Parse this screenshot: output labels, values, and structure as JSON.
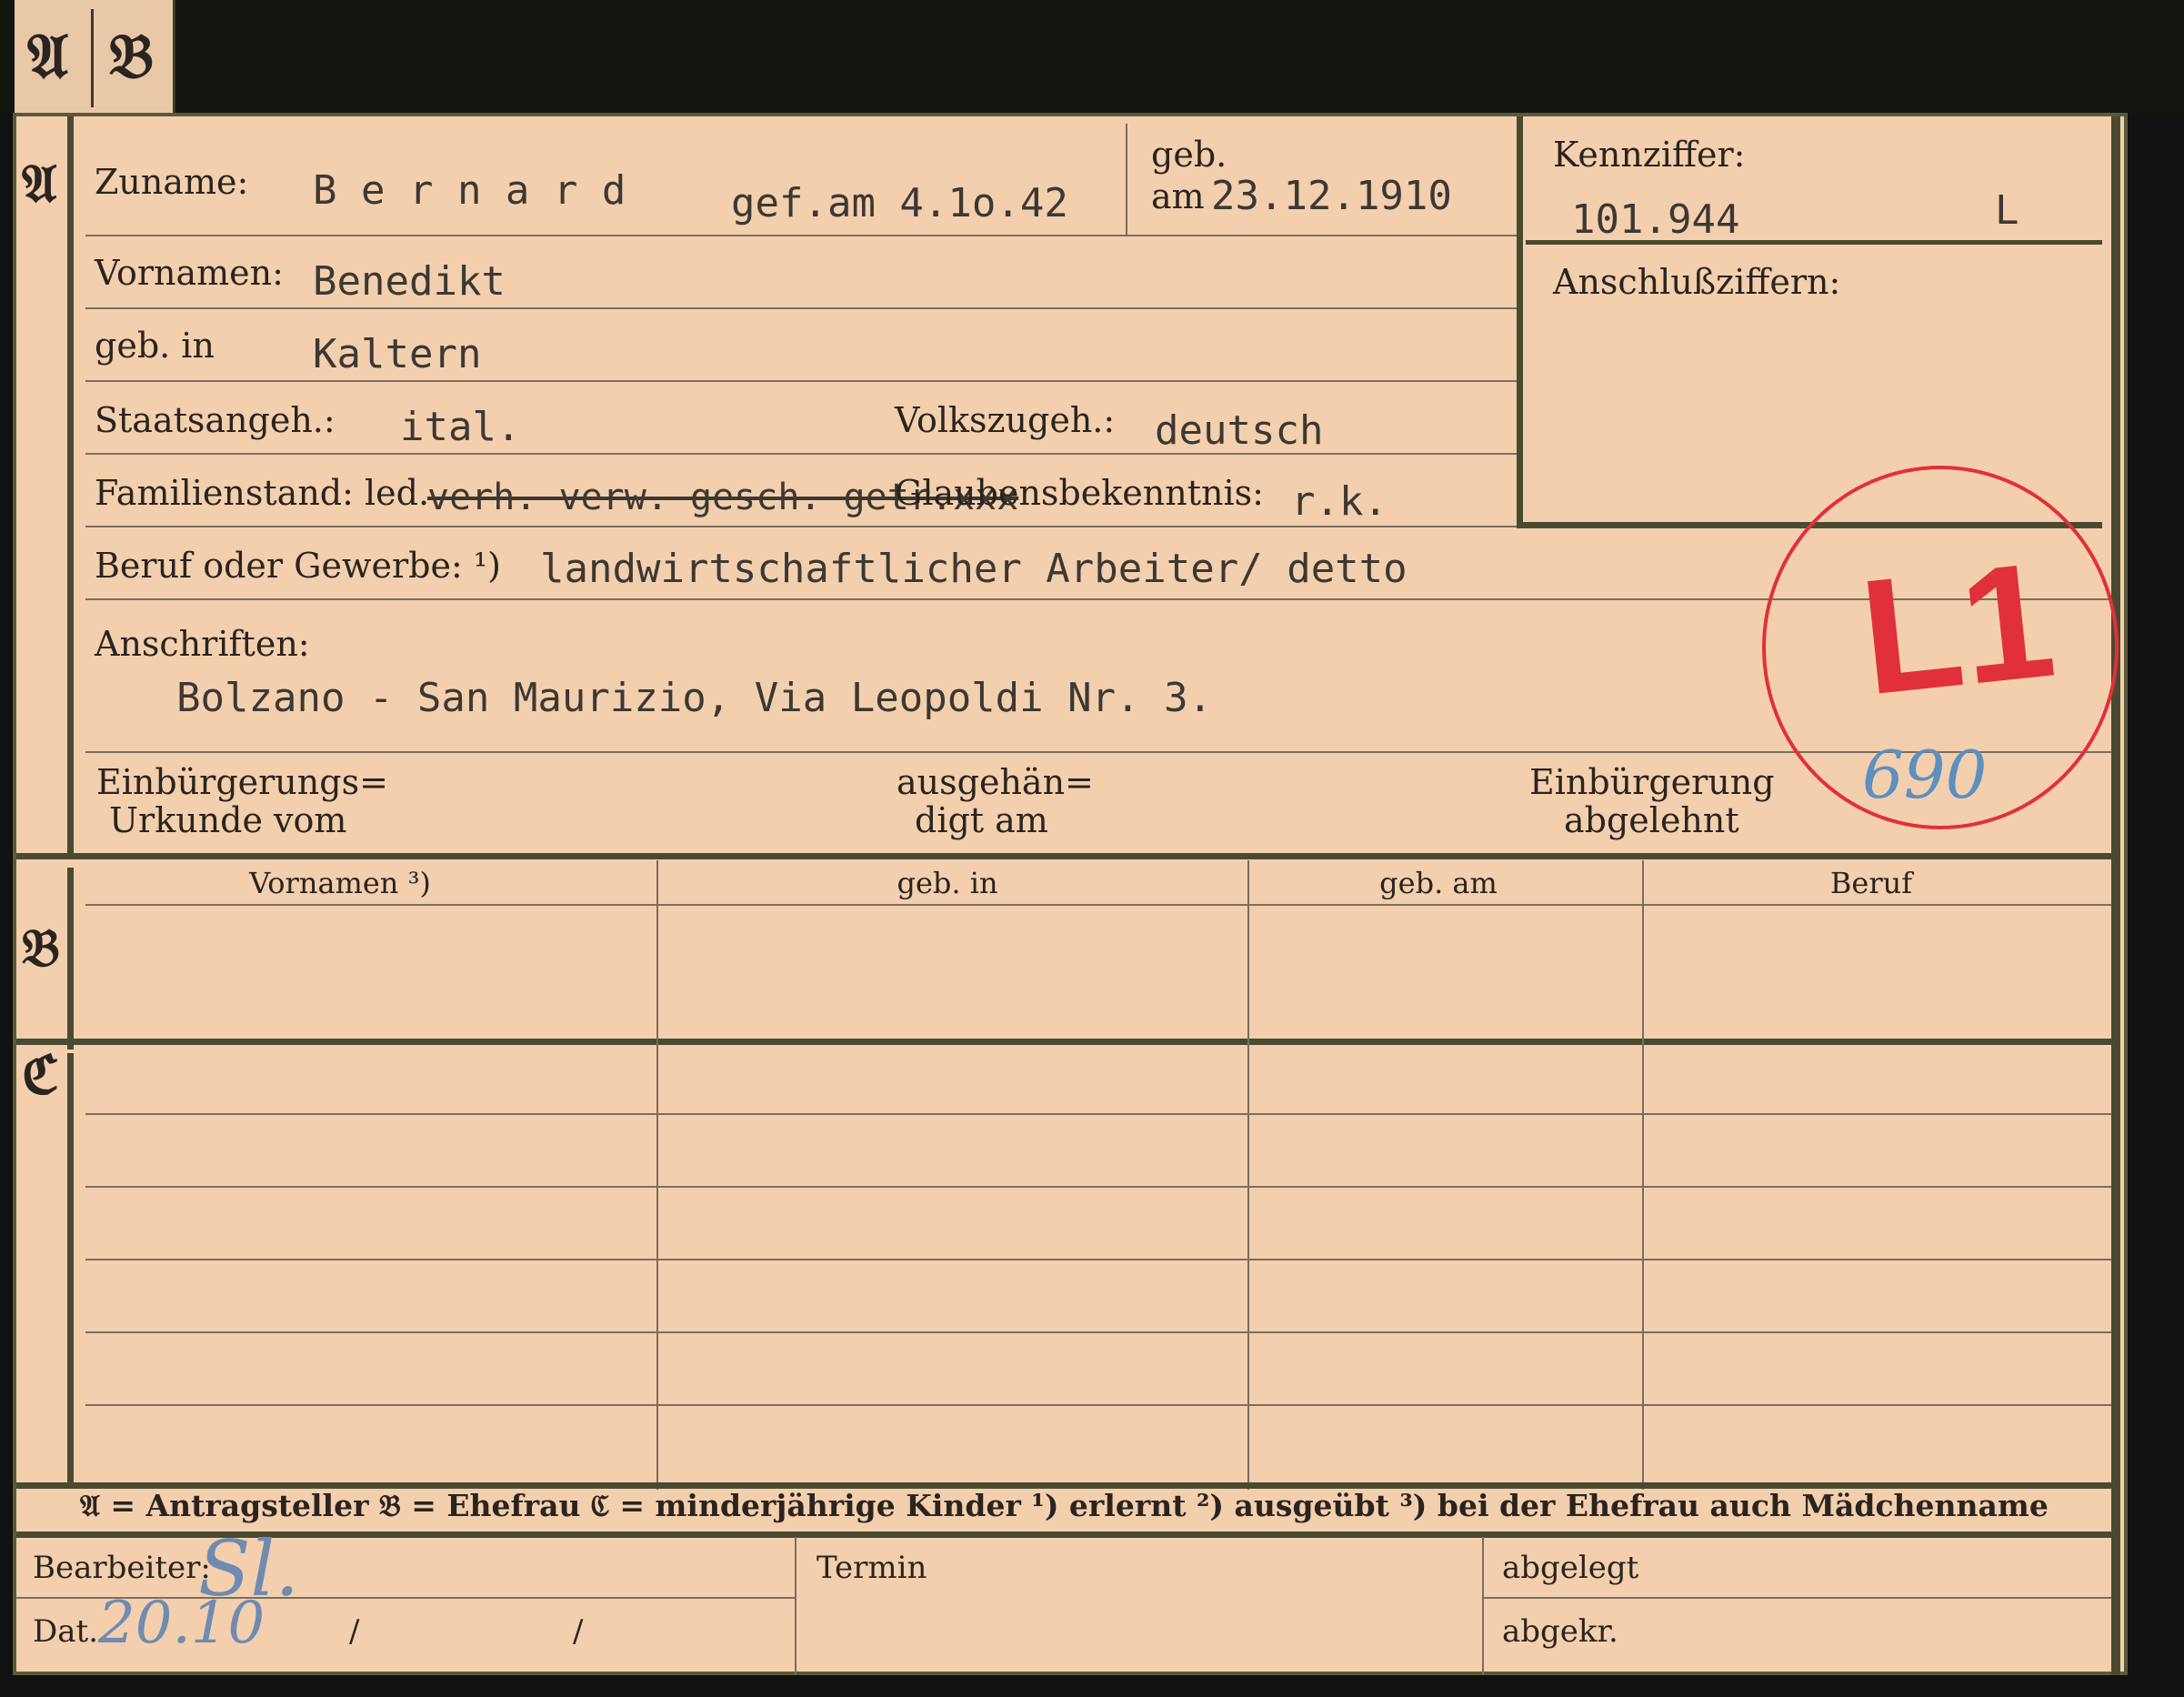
{
  "tab": {
    "a": "𝔄",
    "b": "𝔅"
  },
  "section_marks": {
    "a": "𝔄",
    "b": "𝔅",
    "c": "ℭ"
  },
  "fields": {
    "zuname_label": "Zuname:",
    "zuname_value": "B e r n a r d",
    "zuname_note": "gef.am 4.1o.42",
    "geb_label_1": "geb.",
    "geb_label_2": "am",
    "geb_am_value": "23.12.1910",
    "vornamen_label": "Vornamen:",
    "vornamen_value": "Benedikt",
    "geb_in_label": "geb. in",
    "geb_in_value": "Kaltern",
    "staatsangeh_label": "Staatsangeh.:",
    "staatsangeh_value": "ital.",
    "volkszugeh_label": "Volkszugeh.:",
    "volkszugeh_value": "deutsch",
    "familienstand_label": "Familienstand: led.",
    "familienstand_struck": "verh. verw. gesch. getr.xxx",
    "glauben_label": "Glaubensbekenntnis:",
    "glauben_value": "r.k.",
    "beruf_label": "Beruf oder Gewerbe: ¹)",
    "beruf_value": "landwirtschaftlicher Arbeiter/ detto",
    "anschriften_label": "Anschriften:",
    "anschriften_value": "Bolzano - San Maurizio, Via Leopoldi Nr. 3.",
    "urkunde_label_1": "Einbürgerungs=",
    "urkunde_label_2": "Urkunde vom",
    "ausgehaendigt_1": "ausgehän=",
    "ausgehaendigt_2": "digt am",
    "abgelehnt_1": "Einbürgerung",
    "abgelehnt_2": "abgelehnt"
  },
  "kennziffer": {
    "label": "Kennziffer:",
    "value": "101.944",
    "suffix": "L",
    "anschluss_label": "Anschlußziffern:"
  },
  "stamp": {
    "text": "L1",
    "number": "690",
    "color": "#e0303c"
  },
  "table": {
    "headers": [
      "Vornamen ³)",
      "geb. in",
      "geb. am",
      "Beruf"
    ]
  },
  "legend": "𝔄 = Antragsteller   𝔅 = Ehefrau   ℭ = minderjährige Kinder   ¹) erlernt   ²) ausgeübt   ³) bei der Ehefrau auch Mädchenname",
  "footer": {
    "bearbeiter_label": "Bearbeiter:",
    "bearbeiter_value": "Sl.",
    "dat_label": "Dat.",
    "dat_value": "20.10",
    "slash1": "/",
    "slash2": "/",
    "termin_label": "Termin",
    "abgelegt_label": "abgelegt",
    "abgekr_label": "abgekr."
  }
}
